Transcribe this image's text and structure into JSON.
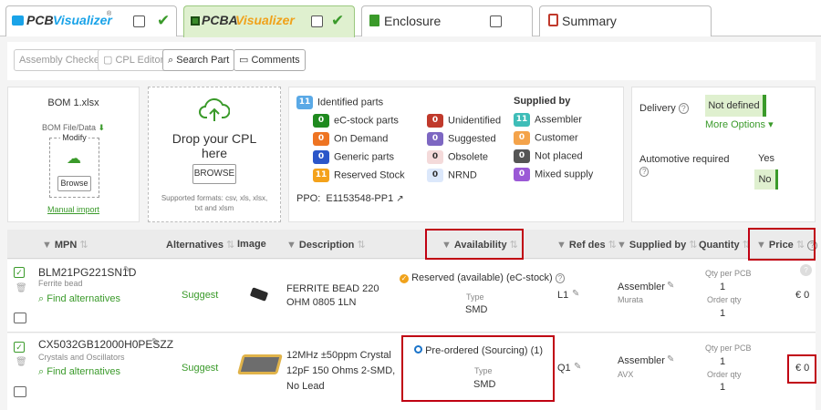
{
  "tabs": [
    {
      "label_a": "PCB",
      "label_b": "Visualizer",
      "reg": "®"
    },
    {
      "label_a": "PCBA",
      "label_b": "Visualizer"
    },
    {
      "label": "Enclosure"
    },
    {
      "label": "Summary"
    }
  ],
  "toolbar": {
    "assembly_checker": "Assembly Checker",
    "cpl_editor": "CPL Editor",
    "search_part": "Search Part",
    "comments": "Comments"
  },
  "bom_card": {
    "filename": "BOM 1.xlsx",
    "file_data": "BOM File/Data",
    "modify": "Modify",
    "browse": "Browse",
    "manual_import": "Manual import"
  },
  "cpl_card": {
    "title": "Drop your CPL here",
    "browse": "BROWSE",
    "formats": "Supported formats: csv, xls, xlsx, txt and xlsm"
  },
  "stats": {
    "identified_count": "11",
    "identified_label": "Identified parts",
    "left": [
      {
        "count": "0",
        "label": "eC-stock parts",
        "color": "#1f8a1f"
      },
      {
        "count": "0",
        "label": "On Demand",
        "color": "#ee7422"
      },
      {
        "count": "0",
        "label": "Generic parts",
        "color": "#2b56c9"
      },
      {
        "count": "11",
        "label": "Reserved Stock",
        "color": "#f4a21b"
      }
    ],
    "middle": [
      {
        "count": "0",
        "label": "Unidentified",
        "color": "#c0392b"
      },
      {
        "count": "0",
        "label": "Suggested",
        "color": "#7d67c2"
      },
      {
        "count": "0",
        "label": "Obsolete",
        "color": "#f4dada"
      },
      {
        "count": "0",
        "label": "NRND",
        "color": "#dce8fb"
      }
    ],
    "supplied_by": "Supplied by",
    "right": [
      {
        "count": "11",
        "label": "Assembler",
        "color": "#3ebdb8"
      },
      {
        "count": "0",
        "label": "Customer",
        "color": "#f4a34a"
      },
      {
        "count": "0",
        "label": "Not placed",
        "color": "#555555"
      },
      {
        "count": "0",
        "label": "Mixed supply",
        "color": "#9b59d6"
      }
    ],
    "ppo_label": "PPO:",
    "ppo_value": "E1153548-PP1"
  },
  "delivery": {
    "label": "Delivery",
    "value": "Not defined",
    "more_options": "More Options",
    "automotive_label": "Automotive required",
    "yes": "Yes",
    "no": "No"
  },
  "columns": {
    "mpn": "MPN",
    "alternatives": "Alternatives",
    "image": "Image",
    "description": "Description",
    "availability": "Availability",
    "ref_des": "Ref des",
    "supplied_by": "Supplied by",
    "quantity": "Quantity",
    "price": "Price"
  },
  "rows": [
    {
      "mpn": "BLM21PG221SN1D",
      "category": "Ferrite bead",
      "find_alternatives": "Find alternatives",
      "suggest": "Suggest",
      "description": "FERRITE BEAD 220 OHM 0805 1LN",
      "availability": "Reserved (available) (eC-stock)",
      "type_label": "Type",
      "type_value": "SMD",
      "ref_des": "L1",
      "supplied_by": "Assembler",
      "manufacturer": "Murata",
      "qty_per_pcb_label": "Qty per PCB",
      "qty_per_pcb": "1",
      "order_qty_label": "Order qty",
      "order_qty": "1",
      "price": "€ 0"
    },
    {
      "mpn": "CX5032GB12000H0PESZZ",
      "category": "Crystals and Oscillators",
      "find_alternatives": "Find alternatives",
      "suggest": "Suggest",
      "description": "12MHz ±50ppm Crystal 12pF 150 Ohms 2-SMD, No Lead",
      "availability": "Pre-ordered (Sourcing) (1)",
      "type_label": "Type",
      "type_value": "SMD",
      "ref_des": "Q1",
      "supplied_by": "Assembler",
      "manufacturer": "AVX",
      "qty_per_pcb_label": "Qty per PCB",
      "qty_per_pcb": "1",
      "order_qty_label": "Order qty",
      "order_qty": "1",
      "price": "€ 0"
    }
  ]
}
